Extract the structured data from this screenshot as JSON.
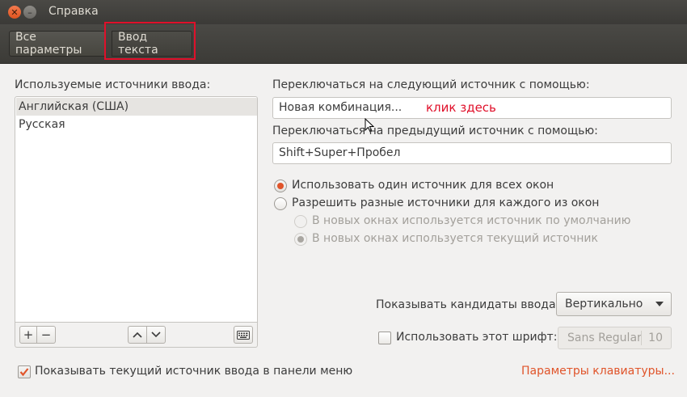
{
  "window": {
    "title": "Справка"
  },
  "breadcrumb": {
    "all_settings": "Все параметры",
    "current": "Ввод текста"
  },
  "sources": {
    "label": "Используемые источники ввода:",
    "items": [
      "Английская (США)",
      "Русская"
    ],
    "selected_index": 0,
    "add_symbol": "+",
    "remove_symbol": "−"
  },
  "switching": {
    "next_label": "Переключаться на следующий источник с помощью:",
    "next_value": "Новая комбинация...",
    "click_note": "клик здесь",
    "prev_label": "Переключаться на предыдущий источник с помощью:",
    "prev_value": "Shift+Super+Пробел"
  },
  "options": {
    "same_for_all": "Использовать один источник для всех окон",
    "per_window": "Разрешить разные источники для каждого из окон",
    "default_source": "В новых окнах используется источник по умолчанию",
    "current_source": "В новых окнах используется текущий источник",
    "selected": "same_for_all"
  },
  "candidates": {
    "label": "Показывать кандидаты ввода:",
    "value": "Вертикально"
  },
  "font": {
    "label": "Использовать этот шрифт:",
    "checked": false,
    "name": "Sans Regular",
    "size": "10"
  },
  "footer": {
    "show_in_menu_label": "Показывать текущий источник ввода в панели меню",
    "show_in_menu_checked": true,
    "keyboard_settings_link": "Параметры клавиатуры..."
  },
  "colors": {
    "accent": "#e0542a",
    "annotation": "#e0102a"
  }
}
